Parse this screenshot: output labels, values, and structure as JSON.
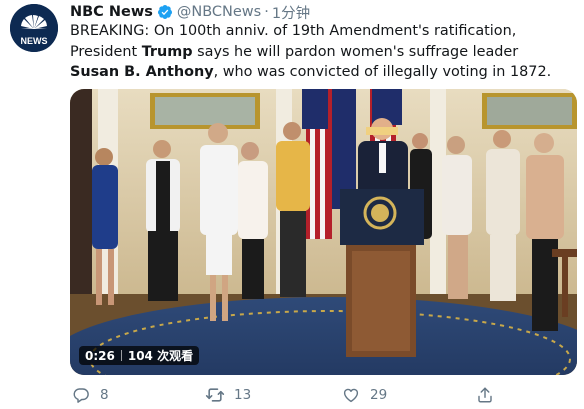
{
  "tweet": {
    "author_name": "NBC News",
    "handle": "@NBCNews",
    "separator": "·",
    "time": "1分钟",
    "avatar_label": "NEWS",
    "text_parts": [
      "BREAKING: On 100th anniv. of 19th Amendment's ratification, President ",
      "Trump",
      " says he will pardon women's suffrage leader ",
      "Susan B. Anthony",
      ", who was convicted of illegally voting in 1872."
    ]
  },
  "media": {
    "duration": "0:26",
    "views": "104 次观看"
  },
  "actions": {
    "replies": "8",
    "retweets": "13",
    "likes": "29"
  },
  "icons": {
    "verified": "verified-badge-icon",
    "reply": "reply-icon",
    "retweet": "retweet-icon",
    "like": "heart-icon",
    "share": "share-icon"
  },
  "colors": {
    "verified": "#1da1f2",
    "secondary_text": "#657786",
    "avatar_bg": "#0d2a52"
  }
}
